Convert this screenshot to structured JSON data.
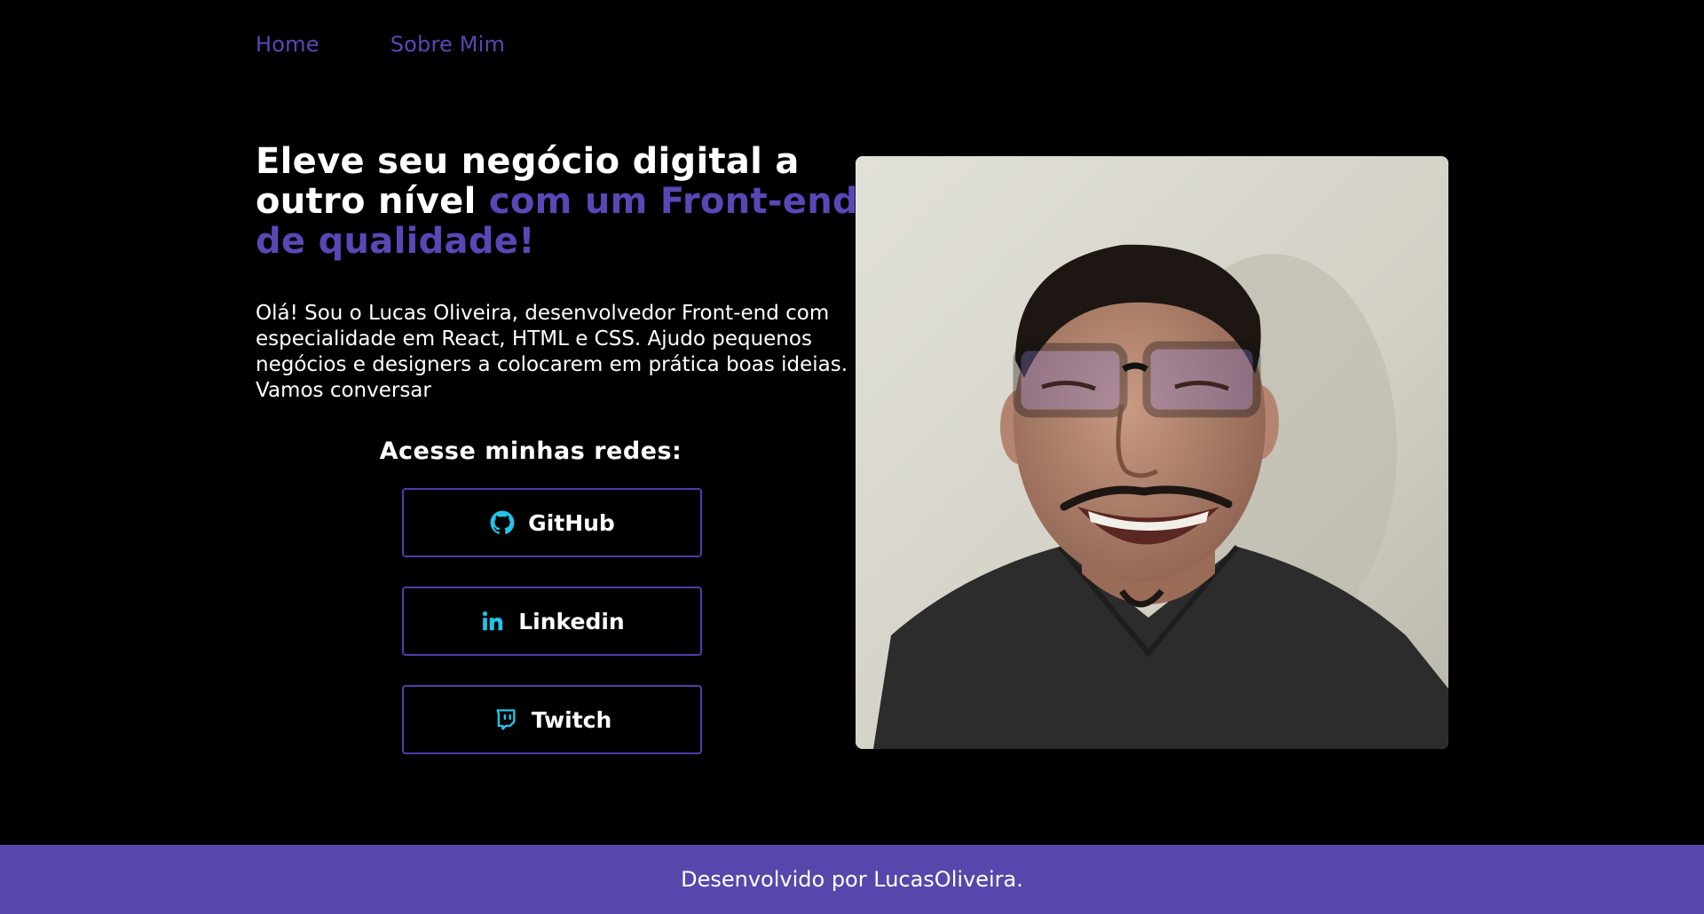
{
  "nav": {
    "items": [
      {
        "label": "Home"
      },
      {
        "label": "Sobre Mim"
      }
    ]
  },
  "hero": {
    "headline_white": "Eleve seu negócio digital a outro nível",
    "headline_accent": "com um Front-end de qualidade!",
    "intro": "Olá! Sou o Lucas Oliveira, desenvolvedor Front-end com especialidade em React, HTML e CSS. Ajudo pequenos negócios e designers a colocarem em prática boas ideias. Vamos conversar",
    "socials_title": "Acesse minhas redes:",
    "socials": [
      {
        "label": "GitHub",
        "icon": "github-icon"
      },
      {
        "label": "Linkedin",
        "icon": "linkedin-icon"
      },
      {
        "label": "Twitch",
        "icon": "twitch-icon"
      }
    ]
  },
  "photo": {
    "alt": "profile-photo"
  },
  "footer": {
    "text": "Desenvolvido por LucasOliveira."
  },
  "colors": {
    "background": "#000000",
    "accent": "#5b46b6",
    "footer_bg": "#5747ac",
    "icon_cyan": "#22c4e8",
    "button_border": "#4f3cad"
  }
}
